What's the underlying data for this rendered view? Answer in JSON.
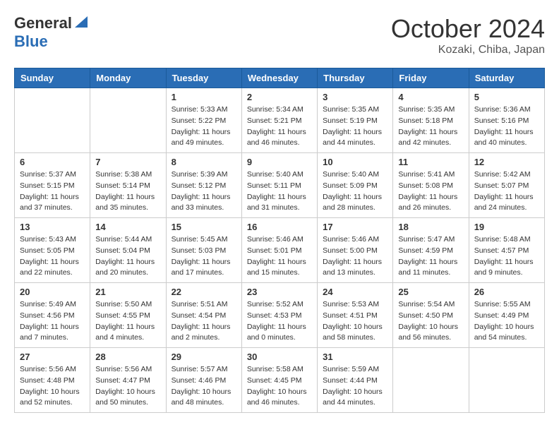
{
  "header": {
    "logo_general": "General",
    "logo_blue": "Blue",
    "month_title": "October 2024",
    "location": "Kozaki, Chiba, Japan"
  },
  "days_of_week": [
    "Sunday",
    "Monday",
    "Tuesday",
    "Wednesday",
    "Thursday",
    "Friday",
    "Saturday"
  ],
  "weeks": [
    [
      {
        "day": "",
        "sunrise": "",
        "sunset": "",
        "daylight": ""
      },
      {
        "day": "",
        "sunrise": "",
        "sunset": "",
        "daylight": ""
      },
      {
        "day": "1",
        "sunrise": "Sunrise: 5:33 AM",
        "sunset": "Sunset: 5:22 PM",
        "daylight": "Daylight: 11 hours and 49 minutes."
      },
      {
        "day": "2",
        "sunrise": "Sunrise: 5:34 AM",
        "sunset": "Sunset: 5:21 PM",
        "daylight": "Daylight: 11 hours and 46 minutes."
      },
      {
        "day": "3",
        "sunrise": "Sunrise: 5:35 AM",
        "sunset": "Sunset: 5:19 PM",
        "daylight": "Daylight: 11 hours and 44 minutes."
      },
      {
        "day": "4",
        "sunrise": "Sunrise: 5:35 AM",
        "sunset": "Sunset: 5:18 PM",
        "daylight": "Daylight: 11 hours and 42 minutes."
      },
      {
        "day": "5",
        "sunrise": "Sunrise: 5:36 AM",
        "sunset": "Sunset: 5:16 PM",
        "daylight": "Daylight: 11 hours and 40 minutes."
      }
    ],
    [
      {
        "day": "6",
        "sunrise": "Sunrise: 5:37 AM",
        "sunset": "Sunset: 5:15 PM",
        "daylight": "Daylight: 11 hours and 37 minutes."
      },
      {
        "day": "7",
        "sunrise": "Sunrise: 5:38 AM",
        "sunset": "Sunset: 5:14 PM",
        "daylight": "Daylight: 11 hours and 35 minutes."
      },
      {
        "day": "8",
        "sunrise": "Sunrise: 5:39 AM",
        "sunset": "Sunset: 5:12 PM",
        "daylight": "Daylight: 11 hours and 33 minutes."
      },
      {
        "day": "9",
        "sunrise": "Sunrise: 5:40 AM",
        "sunset": "Sunset: 5:11 PM",
        "daylight": "Daylight: 11 hours and 31 minutes."
      },
      {
        "day": "10",
        "sunrise": "Sunrise: 5:40 AM",
        "sunset": "Sunset: 5:09 PM",
        "daylight": "Daylight: 11 hours and 28 minutes."
      },
      {
        "day": "11",
        "sunrise": "Sunrise: 5:41 AM",
        "sunset": "Sunset: 5:08 PM",
        "daylight": "Daylight: 11 hours and 26 minutes."
      },
      {
        "day": "12",
        "sunrise": "Sunrise: 5:42 AM",
        "sunset": "Sunset: 5:07 PM",
        "daylight": "Daylight: 11 hours and 24 minutes."
      }
    ],
    [
      {
        "day": "13",
        "sunrise": "Sunrise: 5:43 AM",
        "sunset": "Sunset: 5:05 PM",
        "daylight": "Daylight: 11 hours and 22 minutes."
      },
      {
        "day": "14",
        "sunrise": "Sunrise: 5:44 AM",
        "sunset": "Sunset: 5:04 PM",
        "daylight": "Daylight: 11 hours and 20 minutes."
      },
      {
        "day": "15",
        "sunrise": "Sunrise: 5:45 AM",
        "sunset": "Sunset: 5:03 PM",
        "daylight": "Daylight: 11 hours and 17 minutes."
      },
      {
        "day": "16",
        "sunrise": "Sunrise: 5:46 AM",
        "sunset": "Sunset: 5:01 PM",
        "daylight": "Daylight: 11 hours and 15 minutes."
      },
      {
        "day": "17",
        "sunrise": "Sunrise: 5:46 AM",
        "sunset": "Sunset: 5:00 PM",
        "daylight": "Daylight: 11 hours and 13 minutes."
      },
      {
        "day": "18",
        "sunrise": "Sunrise: 5:47 AM",
        "sunset": "Sunset: 4:59 PM",
        "daylight": "Daylight: 11 hours and 11 minutes."
      },
      {
        "day": "19",
        "sunrise": "Sunrise: 5:48 AM",
        "sunset": "Sunset: 4:57 PM",
        "daylight": "Daylight: 11 hours and 9 minutes."
      }
    ],
    [
      {
        "day": "20",
        "sunrise": "Sunrise: 5:49 AM",
        "sunset": "Sunset: 4:56 PM",
        "daylight": "Daylight: 11 hours and 7 minutes."
      },
      {
        "day": "21",
        "sunrise": "Sunrise: 5:50 AM",
        "sunset": "Sunset: 4:55 PM",
        "daylight": "Daylight: 11 hours and 4 minutes."
      },
      {
        "day": "22",
        "sunrise": "Sunrise: 5:51 AM",
        "sunset": "Sunset: 4:54 PM",
        "daylight": "Daylight: 11 hours and 2 minutes."
      },
      {
        "day": "23",
        "sunrise": "Sunrise: 5:52 AM",
        "sunset": "Sunset: 4:53 PM",
        "daylight": "Daylight: 11 hours and 0 minutes."
      },
      {
        "day": "24",
        "sunrise": "Sunrise: 5:53 AM",
        "sunset": "Sunset: 4:51 PM",
        "daylight": "Daylight: 10 hours and 58 minutes."
      },
      {
        "day": "25",
        "sunrise": "Sunrise: 5:54 AM",
        "sunset": "Sunset: 4:50 PM",
        "daylight": "Daylight: 10 hours and 56 minutes."
      },
      {
        "day": "26",
        "sunrise": "Sunrise: 5:55 AM",
        "sunset": "Sunset: 4:49 PM",
        "daylight": "Daylight: 10 hours and 54 minutes."
      }
    ],
    [
      {
        "day": "27",
        "sunrise": "Sunrise: 5:56 AM",
        "sunset": "Sunset: 4:48 PM",
        "daylight": "Daylight: 10 hours and 52 minutes."
      },
      {
        "day": "28",
        "sunrise": "Sunrise: 5:56 AM",
        "sunset": "Sunset: 4:47 PM",
        "daylight": "Daylight: 10 hours and 50 minutes."
      },
      {
        "day": "29",
        "sunrise": "Sunrise: 5:57 AM",
        "sunset": "Sunset: 4:46 PM",
        "daylight": "Daylight: 10 hours and 48 minutes."
      },
      {
        "day": "30",
        "sunrise": "Sunrise: 5:58 AM",
        "sunset": "Sunset: 4:45 PM",
        "daylight": "Daylight: 10 hours and 46 minutes."
      },
      {
        "day": "31",
        "sunrise": "Sunrise: 5:59 AM",
        "sunset": "Sunset: 4:44 PM",
        "daylight": "Daylight: 10 hours and 44 minutes."
      },
      {
        "day": "",
        "sunrise": "",
        "sunset": "",
        "daylight": ""
      },
      {
        "day": "",
        "sunrise": "",
        "sunset": "",
        "daylight": ""
      }
    ]
  ]
}
